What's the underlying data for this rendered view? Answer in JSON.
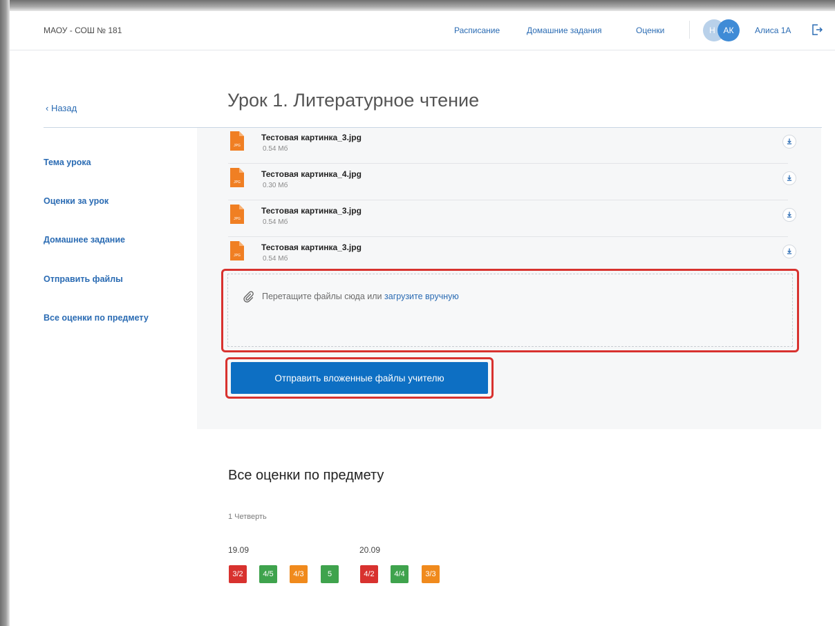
{
  "header": {
    "school": "МАОУ - СОШ № 181",
    "nav": [
      "Расписание",
      "Домашние задания",
      "Оценки"
    ],
    "avatar_back": "Н",
    "avatar_front": "АК",
    "user": "Алиса 1А"
  },
  "sidebar": {
    "back": "‹ Назад",
    "items": [
      "Тема урока",
      "Оценки за урок",
      "Домашнее задание",
      "Отправить файлы",
      "Все оценки по предмету"
    ]
  },
  "lesson": {
    "title": "Урок 1. Литературное чтение"
  },
  "files": [
    {
      "name": "Тестовая картинка_3.jpg",
      "size": "0.54 Мб",
      "type": "JPG"
    },
    {
      "name": "Тестовая картинка_4.jpg",
      "size": "0.30 Мб",
      "type": "JPG"
    },
    {
      "name": "Тестовая картинка_3.jpg",
      "size": "0.54 Мб",
      "type": "JPG"
    },
    {
      "name": "Тестовая картинка_3.jpg",
      "size": "0.54 Мб",
      "type": "JPG"
    }
  ],
  "upload": {
    "text": "Перетащите файлы сюда или ",
    "link": "загрузите вручную",
    "button": "Отправить вложенные файлы учителю"
  },
  "grades": {
    "title": "Все оценки по предмету",
    "period": "1 Четверть",
    "days": [
      {
        "date": "19.09",
        "marks": [
          {
            "value": "3/2",
            "color": "#d8322f"
          },
          {
            "value": "4/5",
            "color": "#3fa34d"
          },
          {
            "value": "4/3",
            "color": "#f08a1d"
          },
          {
            "value": "5",
            "color": "#3fa34d"
          }
        ]
      },
      {
        "date": "20.09",
        "marks": [
          {
            "value": "4/2",
            "color": "#d8322f"
          },
          {
            "value": "4/4",
            "color": "#3fa34d"
          },
          {
            "value": "3/3",
            "color": "#f08a1d"
          }
        ]
      }
    ]
  },
  "colors": {
    "accent": "#0d6fc3",
    "link": "#2a6bb3",
    "highlight": "#d8322f",
    "file_icon": "#f07f23"
  }
}
